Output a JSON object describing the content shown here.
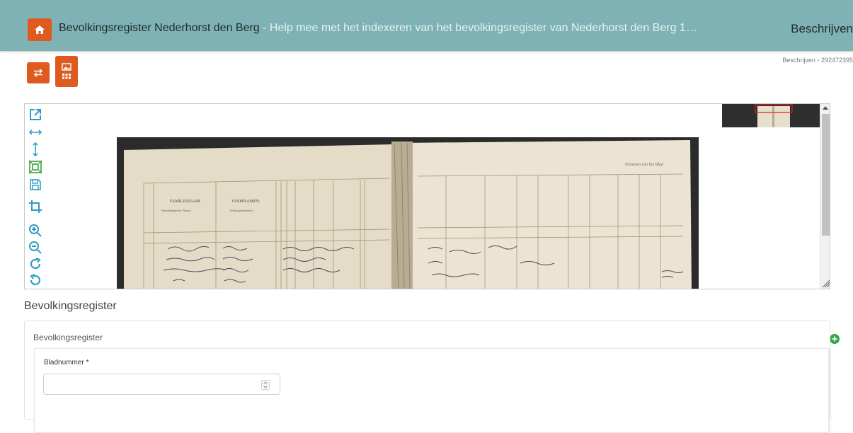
{
  "header": {
    "title": "Bevolkingsregister Nederhorst den Berg",
    "subtitle": " - Help mee met het indexeren van het bevolkingsregister van Nederhorst den Berg 1…",
    "mode_title": "Beschrijven",
    "home_icon": "home-icon"
  },
  "toolbar": {
    "buttons": [
      {
        "name": "swap-layout-button",
        "icon": "swap-arrows-icon"
      },
      {
        "name": "image-grid-layout-button",
        "icon": "image-grid-icon"
      }
    ]
  },
  "reference": "Beschrijven - 292472395",
  "viewer": {
    "tools": [
      {
        "name": "open-external-icon"
      },
      {
        "name": "fit-width-icon"
      },
      {
        "name": "fit-height-icon"
      },
      {
        "name": "fit-page-icon"
      },
      {
        "name": "save-icon"
      },
      {
        "name": "crop-icon"
      },
      {
        "name": "zoom-in-icon"
      },
      {
        "name": "zoom-out-icon"
      },
      {
        "name": "rotate-right-icon"
      },
      {
        "name": "rotate-left-icon"
      }
    ],
    "page_heading": "Pensioen van het Blad",
    "left_headers": [
      "FAMILIENAAM.",
      "VOORNAMEN."
    ],
    "left_subheaders": [
      "(Familienaam der Vrouw.)",
      "(Voluit geschreven.)"
    ]
  },
  "form": {
    "section_title": "Bevolkingsregister",
    "panel_title": "Bevolkingsregister",
    "field_label": "Bladnummer *",
    "field_value": ""
  },
  "colors": {
    "header_bg": "#7fb2b5",
    "accent": "#de5a1f",
    "tool_icon": "#2f9ec4",
    "add_green": "#2fa84f"
  }
}
